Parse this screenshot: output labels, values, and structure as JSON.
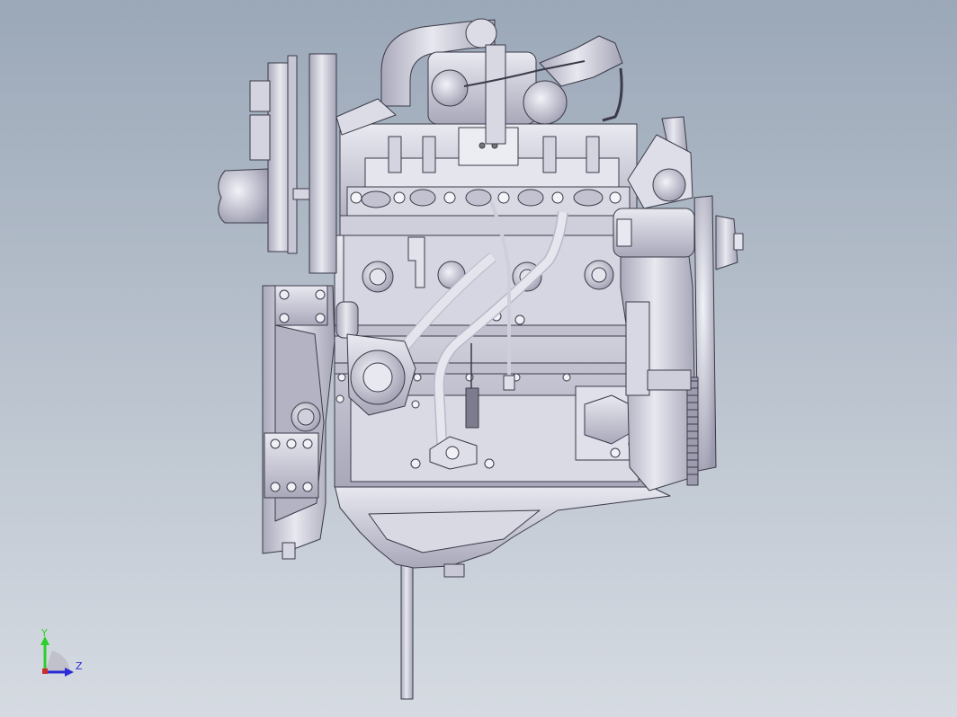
{
  "viewport": {
    "background_top": "#9ba8b8",
    "background_bottom": "#d6dbe2",
    "model_fill": "#c9c9d6",
    "model_fill_light": "#e6e6ee",
    "model_fill_dark": "#8c8ca0",
    "model_stroke": "#3a3a48"
  },
  "triad": {
    "y_label": "Y",
    "z_label": "Z",
    "y_color": "#2bd02b",
    "z_color": "#2b2bd8",
    "x_color": "#d02b2b"
  }
}
